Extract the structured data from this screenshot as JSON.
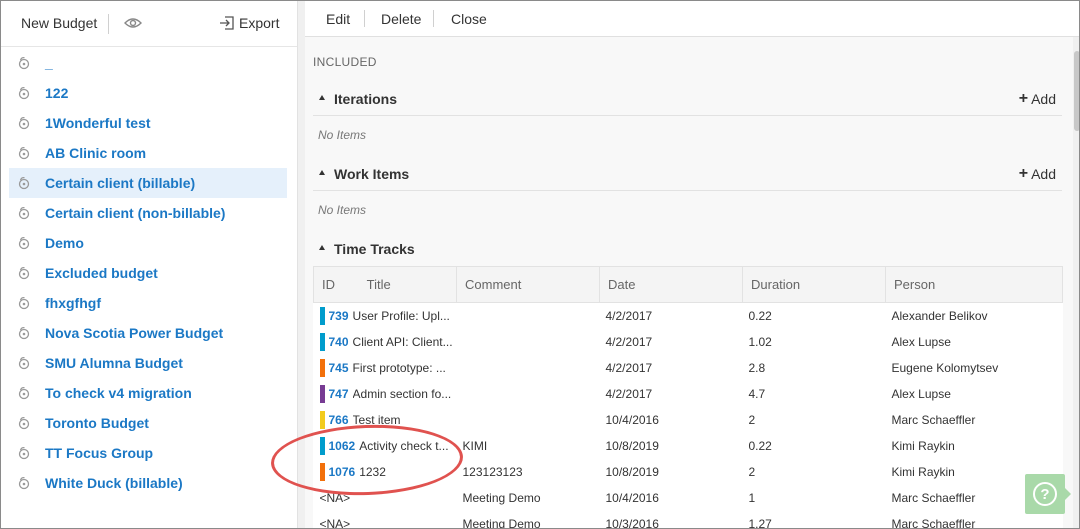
{
  "left_toolbar": {
    "new_budget": "New Budget",
    "export": "Export"
  },
  "budgets": [
    {
      "label": "_",
      "selected": false
    },
    {
      "label": "122",
      "selected": false
    },
    {
      "label": "1Wonderful test",
      "selected": false
    },
    {
      "label": "AB Clinic room",
      "selected": false
    },
    {
      "label": "Certain client (billable)",
      "selected": true
    },
    {
      "label": "Certain client (non-billable)",
      "selected": false
    },
    {
      "label": "Demo",
      "selected": false
    },
    {
      "label": "Excluded budget",
      "selected": false
    },
    {
      "label": "fhxgfhgf",
      "selected": false
    },
    {
      "label": "Nova Scotia Power Budget",
      "selected": false
    },
    {
      "label": "SMU Alumna Budget",
      "selected": false
    },
    {
      "label": "To check v4 migration",
      "selected": false
    },
    {
      "label": "Toronto Budget",
      "selected": false
    },
    {
      "label": "TT Focus Group",
      "selected": false
    },
    {
      "label": "White Duck (billable)",
      "selected": false
    }
  ],
  "right_toolbar": {
    "edit": "Edit",
    "delete": "Delete",
    "close": "Close"
  },
  "included_label": "INCLUDED",
  "sections": {
    "iterations": {
      "title": "Iterations",
      "add": "Add",
      "empty": "No Items"
    },
    "work_items": {
      "title": "Work Items",
      "add": "Add",
      "empty": "No Items"
    },
    "time_tracks": {
      "title": "Time Tracks"
    }
  },
  "table": {
    "headers": {
      "id": "ID",
      "title": "Title",
      "comment": "Comment",
      "date": "Date",
      "duration": "Duration",
      "person": "Person"
    },
    "rows": [
      {
        "id": "739",
        "title": "User Profile: Upl...",
        "comment": "",
        "date": "4/2/2017",
        "duration": "0.22",
        "person": "Alexander Belikov",
        "color": "#009ccc"
      },
      {
        "id": "740",
        "title": "Client API: Client...",
        "comment": "",
        "date": "4/2/2017",
        "duration": "1.02",
        "person": "Alex Lupse",
        "color": "#009ccc"
      },
      {
        "id": "745",
        "title": "First prototype: ...",
        "comment": "",
        "date": "4/2/2017",
        "duration": "2.8",
        "person": "Eugene Kolomytsev",
        "color": "#f2700b"
      },
      {
        "id": "747",
        "title": "Admin section fo...",
        "comment": "",
        "date": "4/2/2017",
        "duration": "4.7",
        "person": "Alex Lupse",
        "color": "#773b93"
      },
      {
        "id": "766",
        "title": "Test item",
        "comment": "",
        "date": "10/4/2016",
        "duration": "2",
        "person": "Marc Schaeffler",
        "color": "#f2cb1d"
      },
      {
        "id": "1062",
        "title": "Activity check t...",
        "comment": "KIMI",
        "date": "10/8/2019",
        "duration": "0.22",
        "person": "Kimi Raykin",
        "color": "#009ccc"
      },
      {
        "id": "1076",
        "title": "1232",
        "comment": "123123123",
        "date": "10/8/2019",
        "duration": "2",
        "person": "Kimi Raykin",
        "color": "#f2700b"
      },
      {
        "id": "",
        "title": "<NA>",
        "comment": "Meeting Demo",
        "date": "10/4/2016",
        "duration": "1",
        "person": "Marc Schaeffler",
        "color": ""
      },
      {
        "id": "",
        "title": "<NA>",
        "comment": "Meeting Demo",
        "date": "10/3/2016",
        "duration": "1.27",
        "person": "Marc Schaeffler",
        "color": ""
      }
    ]
  },
  "help": {
    "label": "?"
  },
  "colors": {
    "link": "#1b78c5",
    "selected_bg": "#e5f0fb",
    "annotation": "#e0524f",
    "help_bg": "#a9d9a9"
  }
}
